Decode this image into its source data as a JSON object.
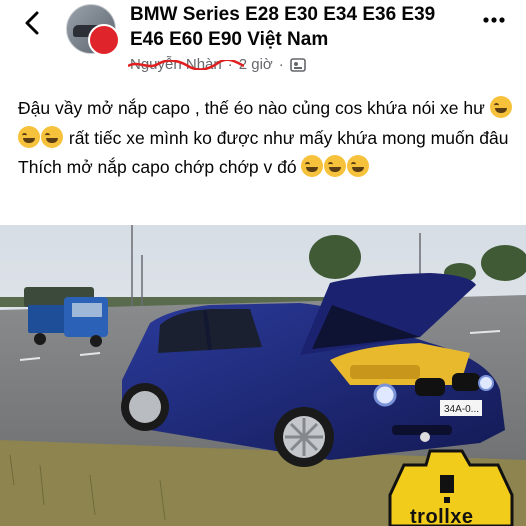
{
  "header": {
    "group_title": "BMW Series E28 E30 E34 E36 E39 E46 E60 E90 Việt Nam",
    "author": "Nguyễn Nhàn",
    "time": "2 giờ",
    "separator": "·",
    "icons": {
      "back": "chevron-left-icon",
      "more": "more-horizontal-icon",
      "audience": "group-audience-icon"
    }
  },
  "post": {
    "line1": "Đậu vầy mở nắp capo , thế éo nào củng cos khứa nói xe hư",
    "line1_after_emoji": "rất tiếc xe mình ko được như mấy khứa mong muốn đâu",
    "line2": "Thích mở nắp capo chớp chớp v đó",
    "emoji": "rolling-on-floor-laughing"
  },
  "photo": {
    "plate": "34A-0...",
    "watermark": "trollxe",
    "colors": {
      "car": "#1f2a7a",
      "engine": "#e8b92c",
      "logo": "#f2cc1b"
    }
  }
}
